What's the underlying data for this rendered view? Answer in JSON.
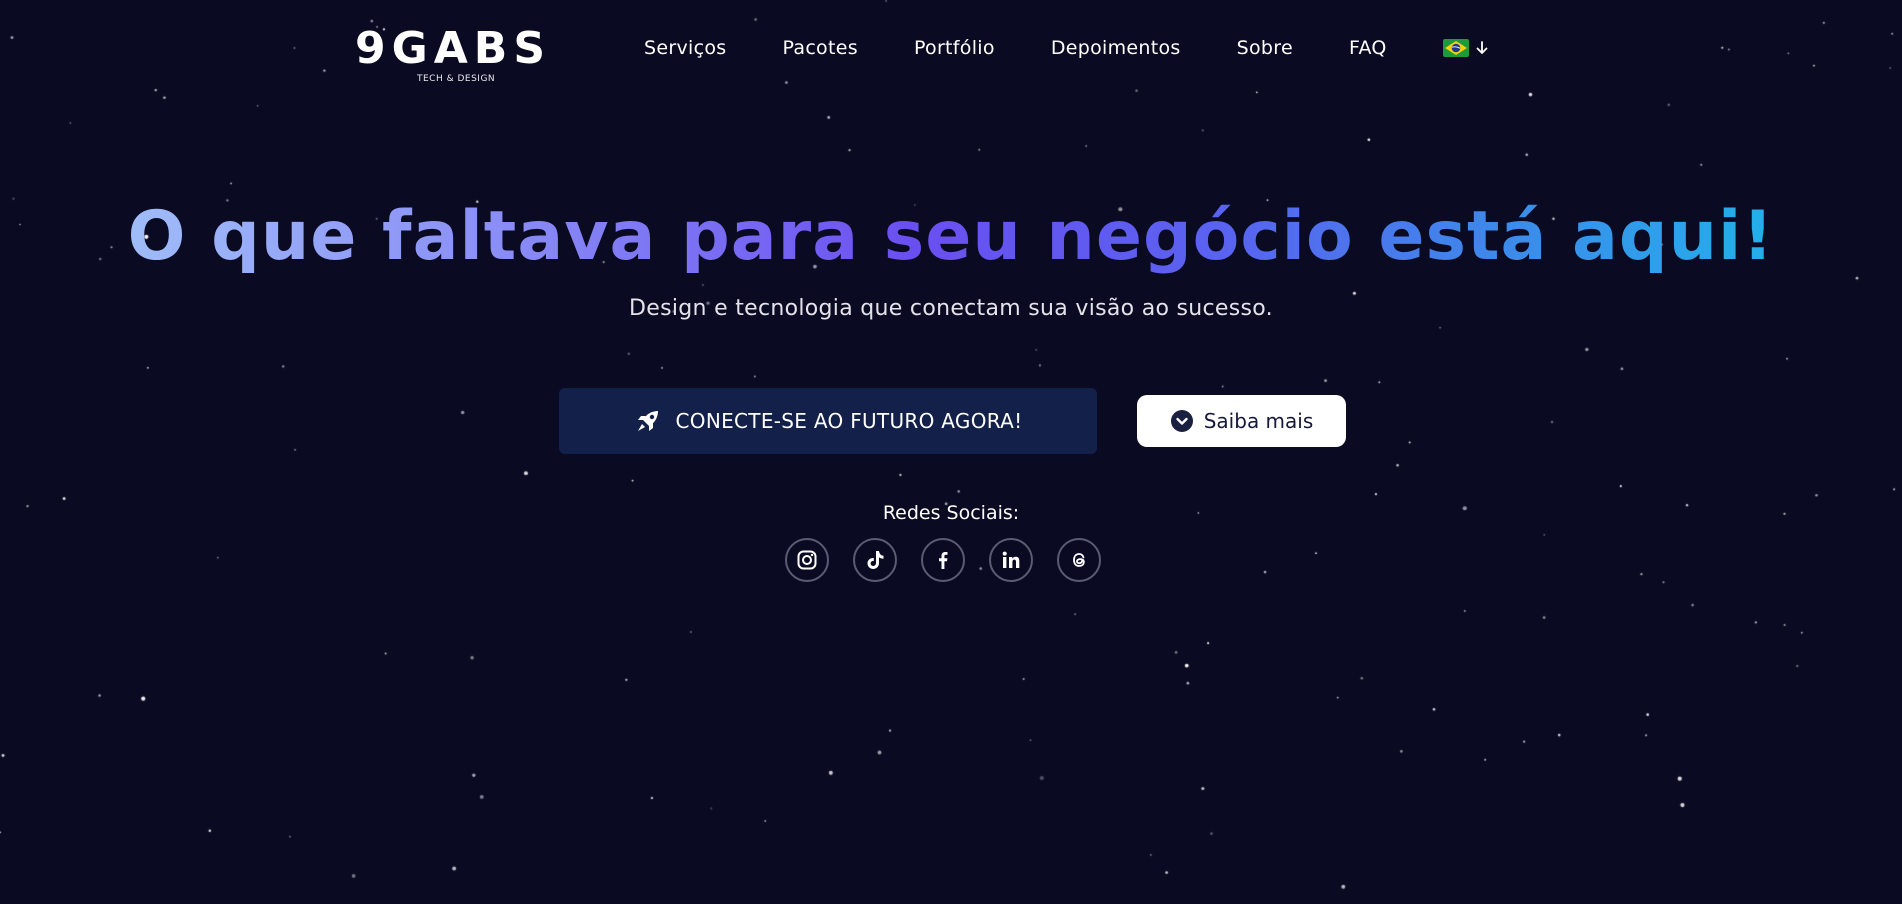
{
  "brand": {
    "logo_text": "9GABS",
    "tagline": "TECH & DESIGN"
  },
  "nav": {
    "items": [
      "Serviços",
      "Pacotes",
      "Portfólio",
      "Depoimentos",
      "Sobre",
      "FAQ"
    ],
    "language": {
      "flag_icon": "brazil-flag-icon",
      "toggle_icon": "arrow-down-icon"
    }
  },
  "hero": {
    "headline": "O que faltava para seu negócio está aqui!",
    "subtitle": "Design e tecnologia que conectam sua visão ao sucesso.",
    "cta_label": "CONECTE-SE AO FUTURO AGORA!",
    "cta_icon": "rocket-icon",
    "more_label": "Saiba mais",
    "more_icon": "chevron-down-icon"
  },
  "social": {
    "title": "Redes Sociais:",
    "icons": [
      "instagram-icon",
      "tiktok-icon",
      "facebook-icon",
      "linkedin-icon",
      "threads-icon"
    ]
  },
  "colors": {
    "background": "#0a0b22",
    "cta_background": "#12204a",
    "headline_gradient": [
      "#a7ccf8",
      "#8a8ef6",
      "#6a4ff0",
      "#5a62f0",
      "#3f87ea",
      "#15c3ea"
    ],
    "social_border": "#5a5d72"
  }
}
